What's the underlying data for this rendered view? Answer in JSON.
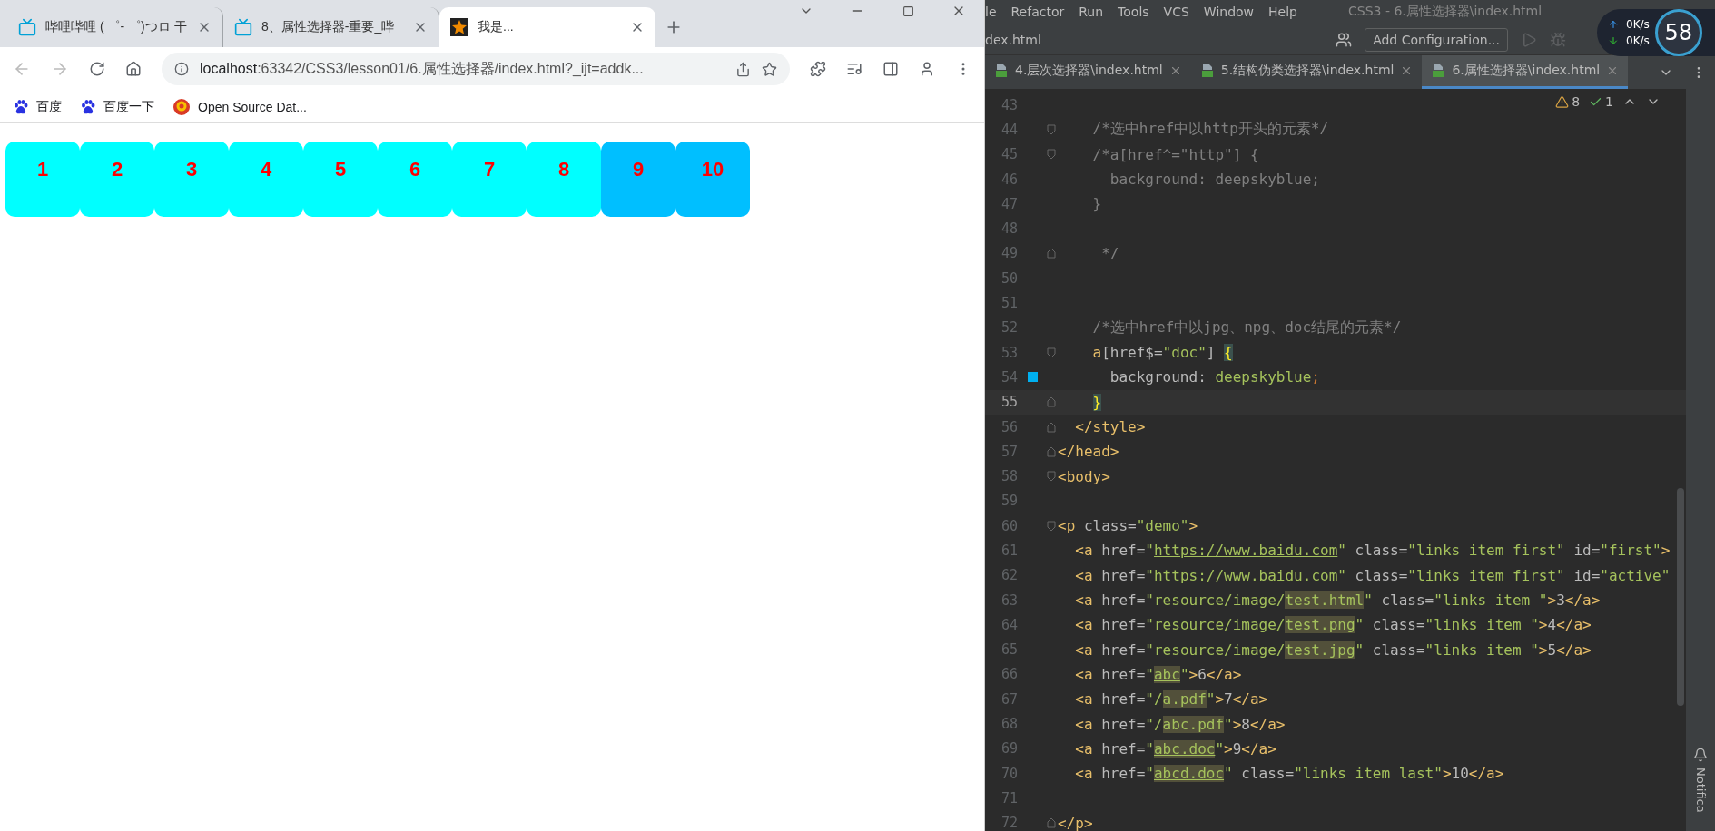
{
  "browser": {
    "tabs": [
      {
        "title": "哔哩哔哩 ( ゜- ゜)つロ 干",
        "selected": false
      },
      {
        "title": "8、属性选择器-重要_哔",
        "selected": false
      },
      {
        "title": "我是...",
        "selected": true
      }
    ],
    "address": {
      "host": "localhost",
      "path": ":63342/CSS3/lesson01/6.属性选择器/index.html?_ijt=addk..."
    },
    "back_disabled": true,
    "forward_disabled": true,
    "bookmarks": [
      {
        "label": "百度"
      },
      {
        "label": "百度一下"
      },
      {
        "label": "Open Source Dat..."
      }
    ],
    "boxes": [
      {
        "label": "1",
        "color": "#00ffff"
      },
      {
        "label": "2",
        "color": "#00ffff"
      },
      {
        "label": "3",
        "color": "#00ffff"
      },
      {
        "label": "4",
        "color": "#00ffff"
      },
      {
        "label": "5",
        "color": "#00ffff"
      },
      {
        "label": "6",
        "color": "#00ffff"
      },
      {
        "label": "7",
        "color": "#00ffff"
      },
      {
        "label": "8",
        "color": "#00ffff"
      },
      {
        "label": "9",
        "color": "#00bfff"
      },
      {
        "label": "10",
        "color": "#00bfff"
      }
    ]
  },
  "ide": {
    "menu": [
      "le",
      "Refactor",
      "Run",
      "Tools",
      "VCS",
      "Window",
      "Help"
    ],
    "title": "CSS3 - 6.属性选择器\\index.html",
    "breadcrumb": "dex.html",
    "run_config": "Add Configuration...",
    "tabs": [
      {
        "label": "4.层次选择器\\index.html",
        "selected": false
      },
      {
        "label": "5.结构伪类选择器\\index.html",
        "selected": false
      },
      {
        "label": "6.属性选择器\\index.html",
        "selected": true
      }
    ],
    "warnings": "8",
    "checks": "1",
    "net": {
      "up": {
        "value": "0",
        "unit": "K/s"
      },
      "down": {
        "value": "0",
        "unit": "K/s"
      },
      "gauge": "58"
    },
    "notifications": "Notifica",
    "lines": [
      {
        "n": "43"
      },
      {
        "n": "44",
        "fold_start": true,
        "tokens": [
          {
            "t": "    /*选中href中以http开头的元素*/",
            "kind": "comment"
          }
        ]
      },
      {
        "n": "45",
        "fold_start": true,
        "tokens": [
          {
            "t": "    /*a[href^=\"http\"] {",
            "kind": "comment"
          }
        ]
      },
      {
        "n": "46",
        "tokens": [
          {
            "t": "      background: deepskyblue;",
            "kind": "comment"
          }
        ]
      },
      {
        "n": "47",
        "tokens": [
          {
            "t": "    }",
            "kind": "comment"
          }
        ]
      },
      {
        "n": "48"
      },
      {
        "n": "49",
        "fold_end": true,
        "tokens": [
          {
            "t": "     */",
            "kind": "comment"
          }
        ]
      },
      {
        "n": "50"
      },
      {
        "n": "51"
      },
      {
        "n": "52",
        "tokens": [
          {
            "t": "    /*选中href中以jpg、npg、doc结尾的元素*/",
            "kind": "comment"
          }
        ]
      },
      {
        "n": "53",
        "fold_start": true,
        "tokens": [
          {
            "t": "    a",
            "kind": "tag"
          },
          {
            "t": "[href$=",
            "kind": "text"
          },
          {
            "t": "\"doc\"",
            "kind": "string"
          },
          {
            "t": "] ",
            "kind": "text"
          },
          {
            "t": "{",
            "kind": "brace"
          }
        ]
      },
      {
        "n": "54",
        "marker": true,
        "tokens": [
          {
            "t": "      background: ",
            "kind": "text"
          },
          {
            "t": "deepskyblue",
            "kind": "string"
          },
          {
            "t": ";",
            "kind": "punct"
          }
        ]
      },
      {
        "n": "55",
        "fold_end": true,
        "current": true,
        "tokens": [
          {
            "t": "    }",
            "kind": "brace"
          }
        ]
      },
      {
        "n": "56",
        "fold_end": true,
        "tokens": [
          {
            "t": "  </style>",
            "kind": "tag"
          }
        ]
      },
      {
        "n": "57",
        "fold_end": true,
        "tokens": [
          {
            "t": "</head>",
            "kind": "tag"
          }
        ]
      },
      {
        "n": "58",
        "fold_start": true,
        "tokens": [
          {
            "t": "<body>",
            "kind": "tag"
          }
        ]
      },
      {
        "n": "59"
      },
      {
        "n": "60",
        "fold_start": true,
        "tokens": [
          {
            "t": "<p",
            "kind": "tag"
          },
          {
            "t": " class=",
            "kind": "attr"
          },
          {
            "t": "\"demo\"",
            "kind": "string"
          },
          {
            "t": ">",
            "kind": "tag"
          }
        ]
      },
      {
        "n": "61",
        "tokens": [
          {
            "t": "  <a",
            "kind": "tag"
          },
          {
            "t": " href=",
            "kind": "attr"
          },
          {
            "t": "\"",
            "kind": "string"
          },
          {
            "t": "https://www.baidu.com",
            "kind": "link"
          },
          {
            "t": "\"",
            "kind": "string"
          },
          {
            "t": " class=",
            "kind": "attr"
          },
          {
            "t": "\"links item first\"",
            "kind": "string"
          },
          {
            "t": " id=",
            "kind": "attr"
          },
          {
            "t": "\"first\"",
            "kind": "string"
          },
          {
            "t": ">",
            "kind": "tag"
          }
        ]
      },
      {
        "n": "62",
        "tokens": [
          {
            "t": "  <a",
            "kind": "tag"
          },
          {
            "t": " href=",
            "kind": "attr"
          },
          {
            "t": "\"",
            "kind": "string"
          },
          {
            "t": "https://www.baidu.com",
            "kind": "link"
          },
          {
            "t": "\"",
            "kind": "string"
          },
          {
            "t": " class=",
            "kind": "attr"
          },
          {
            "t": "\"links item first\"",
            "kind": "string"
          },
          {
            "t": " id=",
            "kind": "attr"
          },
          {
            "t": "\"active\"",
            "kind": "string"
          }
        ]
      },
      {
        "n": "63",
        "tokens": [
          {
            "t": "  <a",
            "kind": "tag"
          },
          {
            "t": " href=",
            "kind": "attr"
          },
          {
            "t": "\"resource/image/",
            "kind": "string"
          },
          {
            "t": "test.html",
            "kind": "mark"
          },
          {
            "t": "\"",
            "kind": "string"
          },
          {
            "t": " class=",
            "kind": "attr"
          },
          {
            "t": "\"links item \"",
            "kind": "string"
          },
          {
            "t": ">",
            "kind": "tag"
          },
          {
            "t": "3",
            "kind": "text"
          },
          {
            "t": "</a>",
            "kind": "tag"
          }
        ]
      },
      {
        "n": "64",
        "tokens": [
          {
            "t": "  <a",
            "kind": "tag"
          },
          {
            "t": " href=",
            "kind": "attr"
          },
          {
            "t": "\"resource/image/",
            "kind": "string"
          },
          {
            "t": "test.png",
            "kind": "mark"
          },
          {
            "t": "\"",
            "kind": "string"
          },
          {
            "t": " class=",
            "kind": "attr"
          },
          {
            "t": "\"links item \"",
            "kind": "string"
          },
          {
            "t": ">",
            "kind": "tag"
          },
          {
            "t": "4",
            "kind": "text"
          },
          {
            "t": "</a>",
            "kind": "tag"
          }
        ]
      },
      {
        "n": "65",
        "tokens": [
          {
            "t": "  <a",
            "kind": "tag"
          },
          {
            "t": " href=",
            "kind": "attr"
          },
          {
            "t": "\"resource/image/",
            "kind": "string"
          },
          {
            "t": "test.jpg",
            "kind": "mark"
          },
          {
            "t": "\"",
            "kind": "string"
          },
          {
            "t": " class=",
            "kind": "attr"
          },
          {
            "t": "\"links item \"",
            "kind": "string"
          },
          {
            "t": ">",
            "kind": "tag"
          },
          {
            "t": "5",
            "kind": "text"
          },
          {
            "t": "</a>",
            "kind": "tag"
          }
        ]
      },
      {
        "n": "66",
        "tokens": [
          {
            "t": "  <a",
            "kind": "tag"
          },
          {
            "t": " href=",
            "kind": "attr"
          },
          {
            "t": "\"",
            "kind": "string"
          },
          {
            "t": "abc",
            "kind": "marklink"
          },
          {
            "t": "\"",
            "kind": "string"
          },
          {
            "t": ">",
            "kind": "tag"
          },
          {
            "t": "6",
            "kind": "text"
          },
          {
            "t": "</a>",
            "kind": "tag"
          }
        ]
      },
      {
        "n": "67",
        "tokens": [
          {
            "t": "  <a",
            "kind": "tag"
          },
          {
            "t": " href=",
            "kind": "attr"
          },
          {
            "t": "\"/",
            "kind": "string"
          },
          {
            "t": "a.pdf",
            "kind": "mark"
          },
          {
            "t": "\"",
            "kind": "string"
          },
          {
            "t": ">",
            "kind": "tag"
          },
          {
            "t": "7",
            "kind": "text"
          },
          {
            "t": "</a>",
            "kind": "tag"
          }
        ]
      },
      {
        "n": "68",
        "tokens": [
          {
            "t": "  <a",
            "kind": "tag"
          },
          {
            "t": " href=",
            "kind": "attr"
          },
          {
            "t": "\"/",
            "kind": "string"
          },
          {
            "t": "abc.pdf",
            "kind": "mark"
          },
          {
            "t": "\"",
            "kind": "string"
          },
          {
            "t": ">",
            "kind": "tag"
          },
          {
            "t": "8",
            "kind": "text"
          },
          {
            "t": "</a>",
            "kind": "tag"
          }
        ]
      },
      {
        "n": "69",
        "tokens": [
          {
            "t": "  <a",
            "kind": "tag"
          },
          {
            "t": " href=",
            "kind": "attr"
          },
          {
            "t": "\"",
            "kind": "string"
          },
          {
            "t": "abc.doc",
            "kind": "marklink"
          },
          {
            "t": "\"",
            "kind": "string"
          },
          {
            "t": ">",
            "kind": "tag"
          },
          {
            "t": "9",
            "kind": "text"
          },
          {
            "t": "</a>",
            "kind": "tag"
          }
        ]
      },
      {
        "n": "70",
        "tokens": [
          {
            "t": "  <a",
            "kind": "tag"
          },
          {
            "t": " href=",
            "kind": "attr"
          },
          {
            "t": "\"",
            "kind": "string"
          },
          {
            "t": "abcd.doc",
            "kind": "marklink"
          },
          {
            "t": "\"",
            "kind": "string"
          },
          {
            "t": " class=",
            "kind": "attr"
          },
          {
            "t": "\"links item last\"",
            "kind": "string"
          },
          {
            "t": ">",
            "kind": "tag"
          },
          {
            "t": "10",
            "kind": "text"
          },
          {
            "t": "</a>",
            "kind": "tag"
          }
        ]
      },
      {
        "n": "71"
      },
      {
        "n": "72",
        "fold_end": true,
        "tokens": [
          {
            "t": "</p>",
            "kind": "tag"
          }
        ]
      }
    ]
  }
}
